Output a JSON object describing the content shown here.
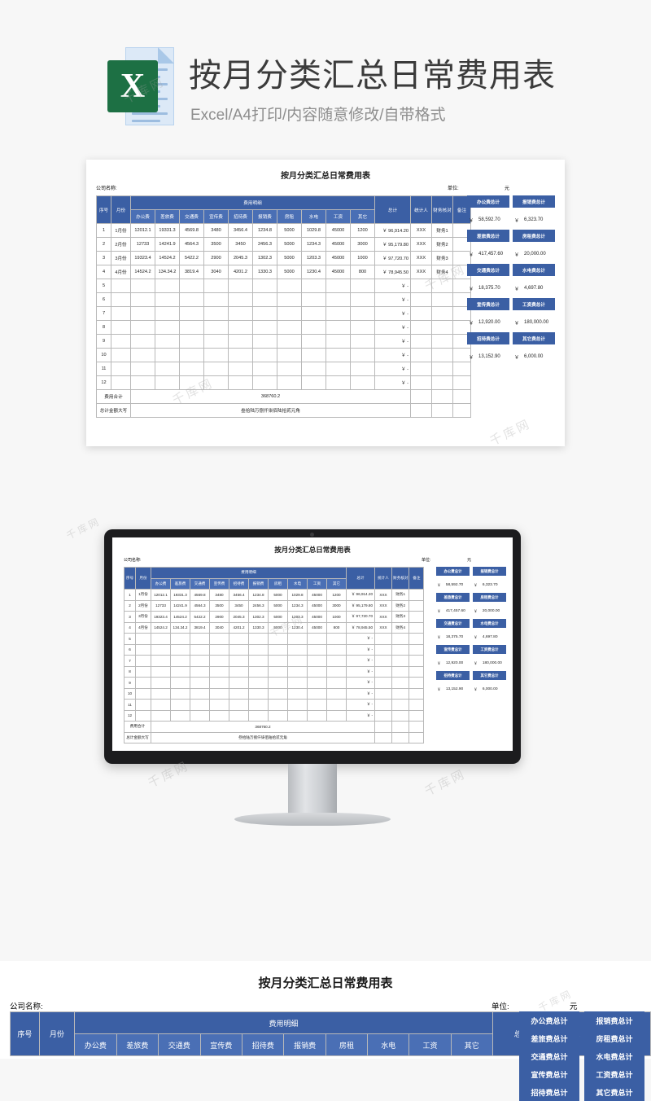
{
  "header": {
    "title": "按月分类汇总日常费用表",
    "subtitle": "Excel/A4打印/内容随意修改/自带格式",
    "logo_letter": "X",
    "logo_icon": "excel-file-icon"
  },
  "sheet": {
    "title": "按月分类汇总日常费用表",
    "company_label": "公司名称:",
    "unit_label": "单位:",
    "unit_value": "元",
    "group_header": "费用明细",
    "columns": {
      "seq": "序号",
      "month": "月份",
      "detail": [
        "办公费",
        "差旅费",
        "交通费",
        "宣传费",
        "招待费",
        "报销费",
        "房租",
        "水电",
        "工资",
        "其它"
      ],
      "total": "总计",
      "accountant": "统计人",
      "checker": "财务核对",
      "remark": "备注"
    },
    "rows": [
      {
        "seq": "1",
        "month": "1月份",
        "vals": [
          "12012.1",
          "19331.3",
          "4569.8",
          "3480",
          "3456.4",
          "1234.8",
          "5000",
          "1029.8",
          "45000",
          "1200"
        ],
        "total": "￥  96,914.20",
        "acc": "XXX",
        "chk": "财务1",
        "remark": ""
      },
      {
        "seq": "2",
        "month": "2月份",
        "vals": [
          "12733",
          "14241.9",
          "4564.3",
          "3500",
          "3450",
          "2456.3",
          "5000",
          "1234.3",
          "45000",
          "3000"
        ],
        "total": "￥  95,179.80",
        "acc": "XXX",
        "chk": "财务2",
        "remark": ""
      },
      {
        "seq": "3",
        "month": "3月份",
        "vals": [
          "19323.4",
          "14524.2",
          "5422.2",
          "2900",
          "2045.3",
          "1302.3",
          "5000",
          "1203.3",
          "45000",
          "1000"
        ],
        "total": "￥  97,720.70",
        "acc": "XXX",
        "chk": "财务3",
        "remark": ""
      },
      {
        "seq": "4",
        "month": "4月份",
        "vals": [
          "14524.2",
          "134.34.2",
          "3819.4",
          "3040",
          "4201.2",
          "1330.3",
          "5000",
          "1230.4",
          "45000",
          "800"
        ],
        "total": "￥  78,945.50",
        "acc": "XXX",
        "chk": "财务4",
        "remark": ""
      },
      {
        "seq": "5",
        "month": "",
        "vals": [
          "",
          "",
          "",
          "",
          "",
          "",
          "",
          "",
          "",
          ""
        ],
        "total": "￥          -",
        "acc": "",
        "chk": "",
        "remark": ""
      },
      {
        "seq": "6",
        "month": "",
        "vals": [
          "",
          "",
          "",
          "",
          "",
          "",
          "",
          "",
          "",
          ""
        ],
        "total": "￥          -",
        "acc": "",
        "chk": "",
        "remark": ""
      },
      {
        "seq": "7",
        "month": "",
        "vals": [
          "",
          "",
          "",
          "",
          "",
          "",
          "",
          "",
          "",
          ""
        ],
        "total": "￥          -",
        "acc": "",
        "chk": "",
        "remark": ""
      },
      {
        "seq": "8",
        "month": "",
        "vals": [
          "",
          "",
          "",
          "",
          "",
          "",
          "",
          "",
          "",
          ""
        ],
        "total": "￥          -",
        "acc": "",
        "chk": "",
        "remark": ""
      },
      {
        "seq": "9",
        "month": "",
        "vals": [
          "",
          "",
          "",
          "",
          "",
          "",
          "",
          "",
          "",
          ""
        ],
        "total": "￥          -",
        "acc": "",
        "chk": "",
        "remark": ""
      },
      {
        "seq": "10",
        "month": "",
        "vals": [
          "",
          "",
          "",
          "",
          "",
          "",
          "",
          "",
          "",
          ""
        ],
        "total": "￥          -",
        "acc": "",
        "chk": "",
        "remark": ""
      },
      {
        "seq": "11",
        "month": "",
        "vals": [
          "",
          "",
          "",
          "",
          "",
          "",
          "",
          "",
          "",
          ""
        ],
        "total": "￥          -",
        "acc": "",
        "chk": "",
        "remark": ""
      },
      {
        "seq": "12",
        "month": "",
        "vals": [
          "",
          "",
          "",
          "",
          "",
          "",
          "",
          "",
          "",
          ""
        ],
        "total": "￥          -",
        "acc": "",
        "chk": "",
        "remark": ""
      }
    ],
    "footer": {
      "total_label": "费用合计",
      "total_value": "368760.2",
      "capital_label": "总计金额大写",
      "capital_value": "叁拾陆万捌仟柒佰陆拾贰元角"
    },
    "summary": [
      {
        "button": "办公费总计",
        "value": "58,592.70"
      },
      {
        "button": "报销费总计",
        "value": "6,323.70"
      },
      {
        "button": "差旅费总计",
        "value": "417,457.60"
      },
      {
        "button": "房租费总计",
        "value": "20,000.00"
      },
      {
        "button": "交通费总计",
        "value": "18,375.70"
      },
      {
        "button": "水电费总计",
        "value": "4,697.80"
      },
      {
        "button": "宣传费总计",
        "value": "12,920.00"
      },
      {
        "button": "工资费总计",
        "value": "180,000.00"
      },
      {
        "button": "招待费总计",
        "value": "13,152.90"
      },
      {
        "button": "其它费总计",
        "value": "6,000.00"
      }
    ],
    "currency_symbol": "￥"
  },
  "watermarks": [
    "千库网",
    "千库网",
    "千库网",
    "千库网",
    "千库网",
    "千库网"
  ],
  "colors": {
    "header_blue": "#3b5fa4",
    "excel_green": "#1d7044",
    "title_gray": "#3b3b3b",
    "subtitle_gray": "#8e8e8e"
  }
}
